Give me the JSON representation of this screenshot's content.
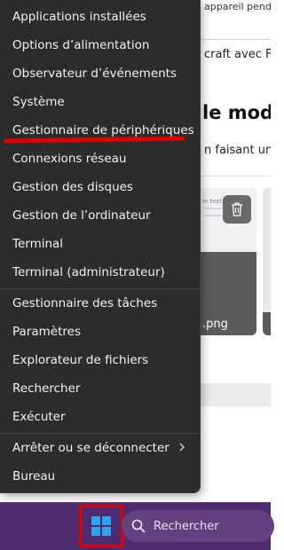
{
  "background": {
    "top_text": "appareil pendant",
    "line2": "craft avec Fon",
    "heading": "le modè",
    "line3": "n faisant un c",
    "thumbnail_text": "le texte produit",
    "thumbnail_filename": ".png"
  },
  "menu": {
    "items": [
      {
        "label": "Applications installées"
      },
      {
        "label": "Options d’alimentation"
      },
      {
        "label": "Observateur d’événements"
      },
      {
        "label": "Système"
      },
      {
        "label": "Gestionnaire de périphériques"
      },
      {
        "label": "Connexions réseau"
      },
      {
        "label": "Gestion des disques"
      },
      {
        "label": "Gestion de l’ordinateur"
      },
      {
        "label": "Terminal"
      },
      {
        "label": "Terminal (administrateur)"
      },
      {
        "label": "Gestionnaire des tâches"
      },
      {
        "label": "Paramètres"
      },
      {
        "label": "Explorateur de fichiers"
      },
      {
        "label": "Rechercher"
      },
      {
        "label": "Exécuter"
      },
      {
        "label": "Arrêter ou se déconnecter",
        "icon": "chevron-right-icon"
      },
      {
        "label": "Bureau"
      }
    ]
  },
  "taskbar": {
    "start_icon": "windows-logo-icon",
    "search_label": "Rechercher",
    "search_icon": "search-icon"
  },
  "colors": {
    "menu_bg": "#2c2c2c",
    "taskbar_bg": "#4f2a6e",
    "annotation_red": "#e00000",
    "windows_blue": "#2ba5ee"
  }
}
